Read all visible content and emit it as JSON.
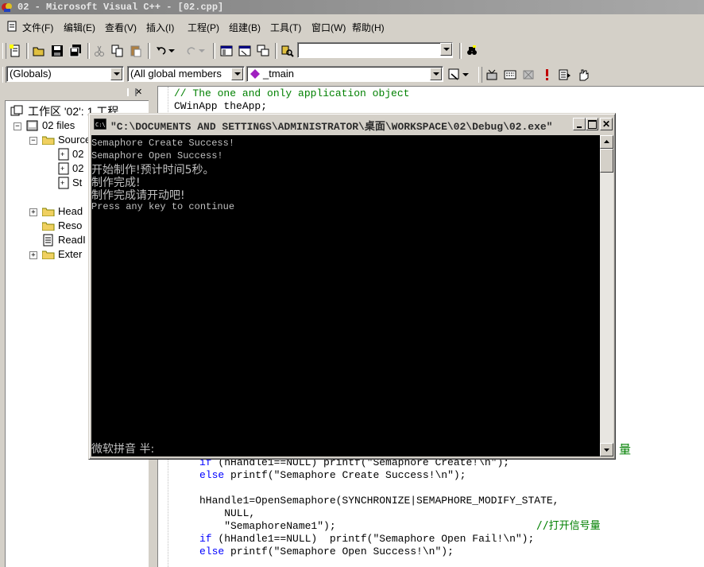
{
  "window": {
    "title": "02 - Microsoft Visual C++ - [02.cpp]"
  },
  "menu": [
    {
      "label": "文件(F)"
    },
    {
      "label": "编辑(E)"
    },
    {
      "label": "查看(V)"
    },
    {
      "label": "插入(I)"
    },
    {
      "label": "工程(P)"
    },
    {
      "label": "组建(B)"
    },
    {
      "label": "工具(T)"
    },
    {
      "label": "窗口(W)"
    },
    {
      "label": "帮助(H)"
    }
  ],
  "toolbar": {
    "find_combo": "",
    "class_combo": "(Globals)",
    "filter_combo": "(All global members",
    "member_combo": "_tmain"
  },
  "workspace": {
    "title": "工作区 '02': 1 工程",
    "items": [
      {
        "label": "02 files"
      },
      {
        "label": "Source"
      },
      {
        "label": "02"
      },
      {
        "label": "02"
      },
      {
        "label": "St"
      },
      {
        "label": "Head"
      },
      {
        "label": "Reso"
      },
      {
        "label": "ReadI"
      },
      {
        "label": "Exter"
      }
    ]
  },
  "editor": {
    "lines_top": [
      {
        "comment": "// The one and only application object"
      },
      {
        "text": "CWinApp theApp;"
      }
    ],
    "side_comment": "量",
    "line_if1_kw": "if",
    "line_if1_rest": " (hHandle1==NULL) printf(\"Semaphore Create!\\n\");",
    "line_else1_kw": "else",
    "line_else1_rest": " printf(\"Semaphore Create Success!\\n\");",
    "line_open": "hHandle1=OpenSemaphore(SYNCHRONIZE|SEMAPHORE_MODIFY_STATE,",
    "line_null": "    NULL,",
    "line_name": "    \"SemaphoreName1\");",
    "comment_open": "//打开信号量",
    "line_if2_kw": "if",
    "line_if2_rest": " (hHandle1==NULL)  printf(\"Semaphore Open Fail!\\n\");",
    "line_else2_kw": "else",
    "line_else2_rest": " printf(\"Semaphore Open Success!\\n\");"
  },
  "console": {
    "title": "\"C:\\DOCUMENTS AND SETTINGS\\ADMINISTRATOR\\桌面\\WORKSPACE\\02\\Debug\\02.exe\"",
    "lines": [
      "Semaphore Create Success!",
      "Semaphore Open Success!",
      "开始制作!预计时间5秒。",
      "制作完成!",
      "制作完成请开动吧!",
      "Press any key to continue"
    ],
    "ime_status": "微软拼音 半:"
  },
  "colors": {
    "keyword": "#0000ff",
    "comment": "#008000"
  }
}
